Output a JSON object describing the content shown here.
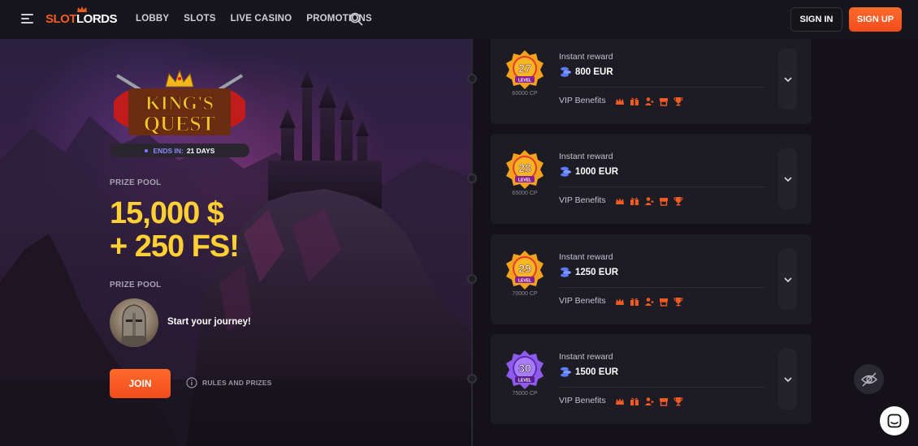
{
  "header": {
    "logo_part1": "SLOT",
    "logo_part2": "LORDS",
    "nav": [
      "LOBBY",
      "SLOTS",
      "LIVE CASINO",
      "PROMOTIONS"
    ],
    "signin_label": "SIGN IN",
    "signup_label": "SIGN UP",
    "accent_color": "#f25a24"
  },
  "promo": {
    "game_logo_line1": "KING'S",
    "game_logo_line2": "QUEST",
    "ends_label": "ENDS IN:",
    "ends_value": "21 DAYS",
    "prize_pool_label": "PRIZE POOL",
    "prize_line1": "15,000 $",
    "prize_line2": "+ 250 FS!",
    "prize_pool_label2": "PRIZE POOL",
    "journey_text": "Start your journey!",
    "join_label": "JOIN",
    "rules_label": "RULES AND PRIZES",
    "prize_color": "#ffd033"
  },
  "levels": [
    {
      "level": "27",
      "level_word": "LEVEL",
      "cp": "60000 CP",
      "reward_label": "Instant reward",
      "amount": "800 EUR",
      "vip_label": "VIP Benefits",
      "badge_color": "orange"
    },
    {
      "level": "28",
      "level_word": "LEVEL",
      "cp": "65000 CP",
      "reward_label": "Instant reward",
      "amount": "1000 EUR",
      "vip_label": "VIP Benefits",
      "badge_color": "orange"
    },
    {
      "level": "29",
      "level_word": "LEVEL",
      "cp": "70000 CP",
      "reward_label": "Instant reward",
      "amount": "1250 EUR",
      "vip_label": "VIP Benefits",
      "badge_color": "orange"
    },
    {
      "level": "30",
      "level_word": "LEVEL",
      "cp": "75000 CP",
      "reward_label": "Instant reward",
      "amount": "1500 EUR",
      "vip_label": "VIP Benefits",
      "badge_color": "purple"
    }
  ],
  "vip_icons": [
    "crown-icon",
    "gift-icon",
    "user-plus-icon",
    "voucher-icon",
    "trophy-icon"
  ]
}
